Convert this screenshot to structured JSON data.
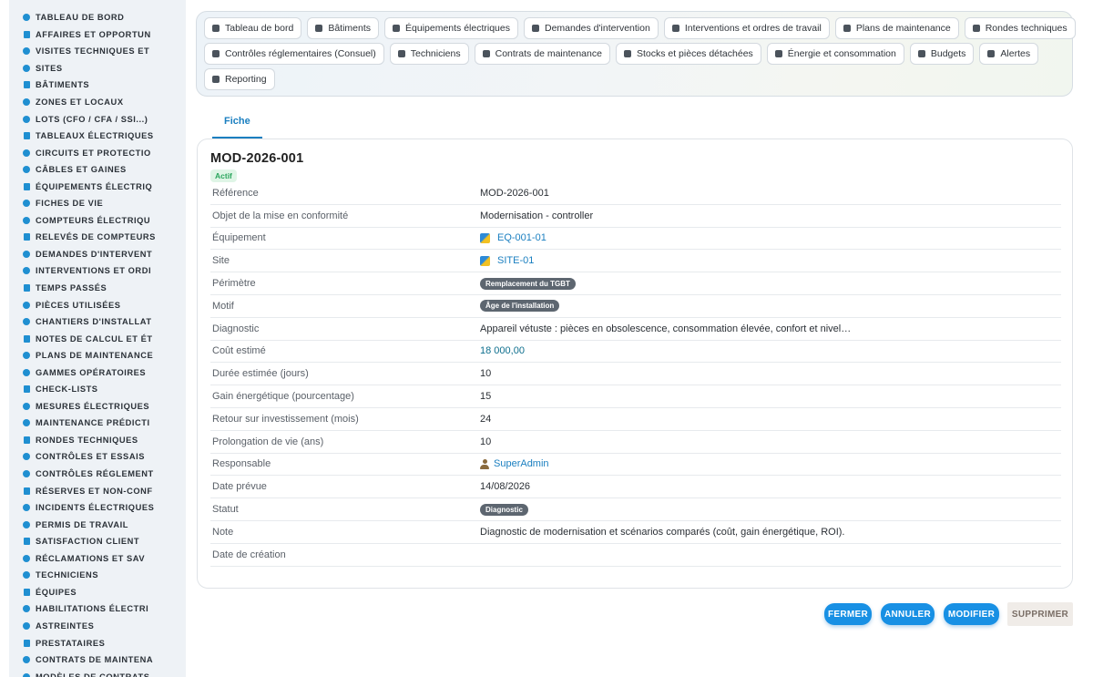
{
  "sidebar": {
    "items": [
      {
        "label": "TABLEAU DE BORD",
        "icon": "dashboard-icon"
      },
      {
        "label": "AFFAIRES ET OPPORTUN",
        "icon": "target-icon"
      },
      {
        "label": "VISITES TECHNIQUES ET",
        "icon": "clipboard-icon"
      },
      {
        "label": "SITES",
        "icon": "map-pin-icon"
      },
      {
        "label": "BÂTIMENTS",
        "icon": "building-icon"
      },
      {
        "label": "ZONES ET LOCAUX",
        "icon": "grid-icon"
      },
      {
        "label": "LOTS (CFO / CFA / SSI...)",
        "icon": "sitemap-icon"
      },
      {
        "label": "TABLEAUX ÉLECTRIQUES",
        "icon": "table-icon"
      },
      {
        "label": "CIRCUITS ET PROTECTIO",
        "icon": "plug-icon"
      },
      {
        "label": "CÂBLES ET GAINES",
        "icon": "cable-icon"
      },
      {
        "label": "ÉQUIPEMENTS ÉLECTRIQ",
        "icon": "gears-icon"
      },
      {
        "label": "FICHES DE VIE",
        "icon": "history-icon"
      },
      {
        "label": "COMPTEURS ÉLECTRIQU",
        "icon": "gauge-icon"
      },
      {
        "label": "RELEVÉS DE COMPTEURS",
        "icon": "readings-icon"
      },
      {
        "label": "DEMANDES D'INTERVENT",
        "icon": "question-icon"
      },
      {
        "label": "INTERVENTIONS ET ORDI",
        "icon": "clipboard-check-icon"
      },
      {
        "label": "TEMPS PASSÉS",
        "icon": "clock-icon"
      },
      {
        "label": "PIÈCES UTILISÉES",
        "icon": "boxes-icon"
      },
      {
        "label": "CHANTIERS D'INSTALLAT",
        "icon": "hammer-icon"
      },
      {
        "label": "NOTES DE CALCUL ET ÉT",
        "icon": "calculator-icon"
      },
      {
        "label": "PLANS DE MAINTENANCE",
        "icon": "calendar-icon"
      },
      {
        "label": "GAMMES OPÉRATOIRES",
        "icon": "list-icon"
      },
      {
        "label": "CHECK-LISTS",
        "icon": "checklist-icon"
      },
      {
        "label": "MESURES ÉLECTRIQUES",
        "icon": "thermometer-icon"
      },
      {
        "label": "MAINTENANCE PRÉDICTI",
        "icon": "chart-line-icon"
      },
      {
        "label": "RONDES TECHNIQUES",
        "icon": "route-icon"
      },
      {
        "label": "CONTRÔLES ET ESSAIS",
        "icon": "search-icon"
      },
      {
        "label": "CONTRÔLES RÉGLEMENT",
        "icon": "clipboard-list-icon"
      },
      {
        "label": "RÉSERVES ET NON-CONF",
        "icon": "alert-circle-icon"
      },
      {
        "label": "INCIDENTS ÉLECTRIQUES",
        "icon": "warning-icon"
      },
      {
        "label": "PERMIS DE TRAVAIL",
        "icon": "file-signature-icon"
      },
      {
        "label": "SATISFACTION CLIENT",
        "icon": "smile-icon"
      },
      {
        "label": "RÉCLAMATIONS ET SAV",
        "icon": "comment-icon"
      },
      {
        "label": "TECHNICIENS",
        "icon": "hard-hat-icon"
      },
      {
        "label": "ÉQUIPES",
        "icon": "users-icon"
      },
      {
        "label": "HABILITATIONS ÉLECTRI",
        "icon": "certificate-icon"
      },
      {
        "label": "ASTREINTES",
        "icon": "phone-icon"
      },
      {
        "label": "PRESTATAIRES",
        "icon": "handshake-icon"
      },
      {
        "label": "CONTRATS DE MAINTENA",
        "icon": "file-contract-icon"
      },
      {
        "label": "MODÈLES DE CONTRATS",
        "icon": "file-template-icon"
      }
    ]
  },
  "nav": {
    "row1": [
      {
        "label": "Tableau de bord",
        "icon": "dashboard-icon"
      },
      {
        "label": "Bâtiments",
        "icon": "building-icon"
      },
      {
        "label": "Équipements électriques",
        "icon": "gears-icon"
      },
      {
        "label": "Demandes d'intervention",
        "icon": "question-icon"
      },
      {
        "label": "Interventions et ordres de travail",
        "icon": "clipboard-check-icon"
      },
      {
        "label": "Plans de maintenance",
        "icon": "calendar-icon"
      },
      {
        "label": "Rondes techniques",
        "icon": "route-icon"
      }
    ],
    "row2": [
      {
        "label": "Contrôles réglementaires (Consuel)",
        "icon": "clipboard-list-icon"
      },
      {
        "label": "Techniciens",
        "icon": "hard-hat-icon"
      },
      {
        "label": "Contrats de maintenance",
        "icon": "file-contract-icon"
      },
      {
        "label": "Stocks et pièces détachées",
        "icon": "boxes-icon"
      },
      {
        "label": "Énergie et consommation",
        "icon": "bolt-icon"
      },
      {
        "label": "Budgets",
        "icon": "money-icon"
      },
      {
        "label": "Alertes",
        "icon": "bell-icon"
      }
    ],
    "row3": [
      {
        "label": "Reporting",
        "icon": "pie-chart-icon"
      }
    ]
  },
  "tabs": [
    {
      "label": "Fiche"
    }
  ],
  "record": {
    "title": "MOD-2026-001",
    "status": "Actif",
    "fields": [
      {
        "label": "Référence",
        "value": "MOD-2026-001",
        "kind": "text"
      },
      {
        "label": "Objet de la mise en conformité",
        "value": "Modernisation - controller",
        "kind": "text"
      },
      {
        "label": "Équipement",
        "value": "EQ-001-01",
        "kind": "link-logo"
      },
      {
        "label": "Site",
        "value": "SITE-01",
        "kind": "link-logo"
      },
      {
        "label": "Périmètre",
        "value": "Remplacement du TGBT",
        "kind": "pill"
      },
      {
        "label": "Motif",
        "value": "Âge de l'installation",
        "kind": "pill"
      },
      {
        "label": "Diagnostic",
        "value": "Appareil vétuste : pièces en obsolescence, consommation élevée, confort et nivel…",
        "kind": "text"
      },
      {
        "label": "Coût estimé",
        "value": "18 000,00",
        "kind": "money"
      },
      {
        "label": "Durée estimée (jours)",
        "value": "10",
        "kind": "text"
      },
      {
        "label": "Gain énergétique (pourcentage)",
        "value": "15",
        "kind": "text"
      },
      {
        "label": "Retour sur investissement (mois)",
        "value": "24",
        "kind": "text"
      },
      {
        "label": "Prolongation de vie (ans)",
        "value": "10",
        "kind": "text"
      },
      {
        "label": "Responsable",
        "value": "SuperAdmin",
        "kind": "link-user"
      },
      {
        "label": "Date prévue",
        "value": "14/08/2026",
        "kind": "text"
      },
      {
        "label": "Statut",
        "value": "Diagnostic",
        "kind": "pill"
      },
      {
        "label": "Note",
        "value": "Diagnostic de modernisation et scénarios comparés (coût, gain énergétique, ROI).",
        "kind": "text"
      },
      {
        "label": "Date de création",
        "value": "",
        "kind": "text"
      }
    ]
  },
  "actions": {
    "close": "FERMER",
    "cancel": "ANNULER",
    "edit": "MODIFIER",
    "delete": "SUPPRIMER"
  },
  "colors": {
    "accent": "#1a7fc0",
    "button_blue": "#1890e4",
    "active_green": "#2aa55d",
    "pill_gray": "#5d6670",
    "sidebar_bg": "#eef2f6"
  }
}
